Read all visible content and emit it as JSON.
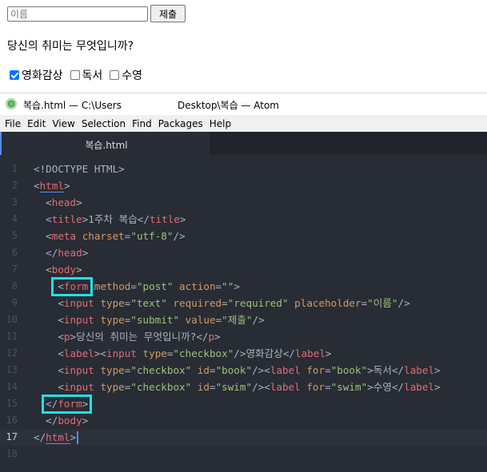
{
  "preview": {
    "input_placeholder": "이름",
    "submit_label": "제출",
    "question": "당신의 취미는 무엇입니까?",
    "checkboxes": [
      {
        "label": "영화감상",
        "checked": true
      },
      {
        "label": "독서",
        "checked": false
      },
      {
        "label": "수영",
        "checked": false
      }
    ]
  },
  "window": {
    "title_left": "복습.html — C:\\Users",
    "title_right": "Desktop\\복습 — Atom"
  },
  "menu": [
    "File",
    "Edit",
    "View",
    "Selection",
    "Find",
    "Packages",
    "Help"
  ],
  "tab": {
    "label": "복습.html"
  },
  "editor": {
    "cursor_line": 17,
    "lines": [
      {
        "n": "1",
        "tokens": [
          [
            "p",
            "<!DOCTYPE HTML>"
          ]
        ]
      },
      {
        "n": "2",
        "tokens": [
          [
            "p",
            "<"
          ],
          [
            "tu",
            "html"
          ],
          [
            "p",
            ">"
          ]
        ]
      },
      {
        "n": "3",
        "tokens": [
          [
            "p",
            "  <"
          ],
          [
            "t",
            "head"
          ],
          [
            "p",
            ">"
          ]
        ]
      },
      {
        "n": "4",
        "tokens": [
          [
            "p",
            "  <"
          ],
          [
            "t",
            "title"
          ],
          [
            "p",
            ">"
          ],
          [
            "x",
            "1주차 복습"
          ],
          [
            "p",
            "</"
          ],
          [
            "t",
            "title"
          ],
          [
            "p",
            ">"
          ]
        ]
      },
      {
        "n": "5",
        "tokens": [
          [
            "p",
            "  <"
          ],
          [
            "t",
            "meta"
          ],
          [
            "p",
            " "
          ],
          [
            "a",
            "charset"
          ],
          [
            "p",
            "="
          ],
          [
            "s",
            "\"utf-8\""
          ],
          [
            "p",
            "/>"
          ]
        ]
      },
      {
        "n": "6",
        "tokens": [
          [
            "p",
            "  </"
          ],
          [
            "t",
            "head"
          ],
          [
            "p",
            ">"
          ]
        ]
      },
      {
        "n": "7",
        "tokens": [
          [
            "p",
            "  <"
          ],
          [
            "t",
            "body"
          ],
          [
            "p",
            ">"
          ]
        ]
      },
      {
        "n": "8",
        "tokens": [
          [
            "p",
            "    <"
          ],
          [
            "t",
            "form"
          ],
          [
            "p",
            " "
          ],
          [
            "a",
            "method"
          ],
          [
            "p",
            "="
          ],
          [
            "s",
            "\"post\""
          ],
          [
            "p",
            " "
          ],
          [
            "a",
            "action"
          ],
          [
            "p",
            "="
          ],
          [
            "s",
            "\"\""
          ],
          [
            "p",
            ">"
          ]
        ]
      },
      {
        "n": "9",
        "tokens": [
          [
            "p",
            "    <"
          ],
          [
            "t",
            "input"
          ],
          [
            "p",
            " "
          ],
          [
            "a",
            "type"
          ],
          [
            "p",
            "="
          ],
          [
            "s",
            "\"text\""
          ],
          [
            "p",
            " "
          ],
          [
            "a",
            "required"
          ],
          [
            "p",
            "="
          ],
          [
            "s",
            "\"required\""
          ],
          [
            "p",
            " "
          ],
          [
            "a",
            "placeholder"
          ],
          [
            "p",
            "="
          ],
          [
            "s",
            "\"이름\""
          ],
          [
            "p",
            "/>"
          ]
        ]
      },
      {
        "n": "10",
        "tokens": [
          [
            "p",
            "    <"
          ],
          [
            "t",
            "input"
          ],
          [
            "p",
            " "
          ],
          [
            "a",
            "type"
          ],
          [
            "p",
            "="
          ],
          [
            "s",
            "\"submit\""
          ],
          [
            "p",
            " "
          ],
          [
            "a",
            "value"
          ],
          [
            "p",
            "="
          ],
          [
            "s",
            "\"제출\""
          ],
          [
            "p",
            "/>"
          ]
        ]
      },
      {
        "n": "11",
        "tokens": [
          [
            "p",
            "    <"
          ],
          [
            "t",
            "p"
          ],
          [
            "p",
            ">"
          ],
          [
            "x",
            "당신의 취미는 무엇입니까?"
          ],
          [
            "p",
            "</"
          ],
          [
            "t",
            "p"
          ],
          [
            "p",
            ">"
          ]
        ]
      },
      {
        "n": "12",
        "tokens": [
          [
            "p",
            "    <"
          ],
          [
            "t",
            "label"
          ],
          [
            "p",
            "><"
          ],
          [
            "t",
            "input"
          ],
          [
            "p",
            " "
          ],
          [
            "a",
            "type"
          ],
          [
            "p",
            "="
          ],
          [
            "s",
            "\"checkbox\""
          ],
          [
            "p",
            "/>"
          ],
          [
            "x",
            "영화감상"
          ],
          [
            "p",
            "</"
          ],
          [
            "t",
            "label"
          ],
          [
            "p",
            ">"
          ]
        ]
      },
      {
        "n": "13",
        "tokens": [
          [
            "p",
            "    <"
          ],
          [
            "t",
            "input"
          ],
          [
            "p",
            " "
          ],
          [
            "a",
            "type"
          ],
          [
            "p",
            "="
          ],
          [
            "s",
            "\"checkbox\""
          ],
          [
            "p",
            " "
          ],
          [
            "a",
            "id"
          ],
          [
            "p",
            "="
          ],
          [
            "s",
            "\"book\""
          ],
          [
            "p",
            "/><"
          ],
          [
            "t",
            "label"
          ],
          [
            "p",
            " "
          ],
          [
            "a",
            "for"
          ],
          [
            "p",
            "="
          ],
          [
            "s",
            "\"book\""
          ],
          [
            "p",
            ">"
          ],
          [
            "x",
            "독서"
          ],
          [
            "p",
            "</"
          ],
          [
            "t",
            "label"
          ],
          [
            "p",
            ">"
          ]
        ]
      },
      {
        "n": "14",
        "tokens": [
          [
            "p",
            "    <"
          ],
          [
            "t",
            "input"
          ],
          [
            "p",
            " "
          ],
          [
            "a",
            "type"
          ],
          [
            "p",
            "="
          ],
          [
            "s",
            "\"checkbox\""
          ],
          [
            "p",
            " "
          ],
          [
            "a",
            "id"
          ],
          [
            "p",
            "="
          ],
          [
            "s",
            "\"swim\""
          ],
          [
            "p",
            "/><"
          ],
          [
            "t",
            "label"
          ],
          [
            "p",
            " "
          ],
          [
            "a",
            "for"
          ],
          [
            "p",
            "="
          ],
          [
            "s",
            "\"swim\""
          ],
          [
            "p",
            ">"
          ],
          [
            "x",
            "수영"
          ],
          [
            "p",
            "</"
          ],
          [
            "t",
            "label"
          ],
          [
            "p",
            ">"
          ]
        ]
      },
      {
        "n": "15",
        "tokens": [
          [
            "p",
            "  </"
          ],
          [
            "t",
            "form"
          ],
          [
            "p",
            ">"
          ]
        ]
      },
      {
        "n": "16",
        "tokens": [
          [
            "p",
            "  </"
          ],
          [
            "t",
            "body"
          ],
          [
            "p",
            ">"
          ]
        ]
      },
      {
        "n": "17",
        "tokens": [
          [
            "p",
            "</"
          ],
          [
            "tu",
            "html"
          ],
          [
            "p",
            ">"
          ]
        ]
      },
      {
        "n": "18",
        "tokens": []
      }
    ]
  }
}
